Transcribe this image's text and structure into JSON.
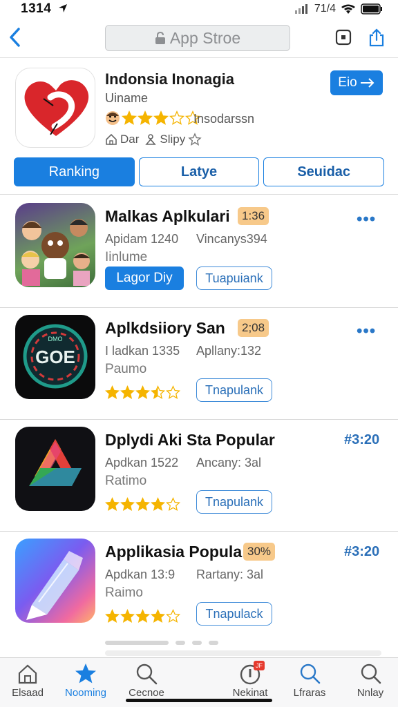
{
  "status_bar": {
    "time": "1314",
    "carrier": "71/4"
  },
  "nav": {
    "url_text": "App Stroe"
  },
  "app": {
    "title": "Indonsia Inonagia",
    "developer": "Uiname",
    "rating_stars": 3,
    "rating_label": "Insodarssn",
    "meta_left": "Dar",
    "meta_right": "Slipy",
    "get_label": "Eio"
  },
  "segments": [
    {
      "label": "Ranking",
      "active": true
    },
    {
      "label": "Latye",
      "active": false
    },
    {
      "label": "Seuidac",
      "active": false
    }
  ],
  "rows": [
    {
      "title": "Malkas Aplkulari",
      "badge": "1:36",
      "meta1": "Apidam 1240",
      "meta2": "Vincanys394",
      "sub": "Iinlume",
      "primary_label": "Lagor Diy",
      "outline_label": "Tuapuiank",
      "more": "•••"
    },
    {
      "title": "Aplkdsiiory San",
      "badge": "2;08",
      "meta1": "I ladkan 1335",
      "meta2": "Apllany:132",
      "sub": "Paumo",
      "stars": 3.5,
      "outline_label": "Tnapulank",
      "more": "•••"
    },
    {
      "title": "Dplydi Aki Sta Popular",
      "rank": "#3:20",
      "meta1": "Apdkan 1522",
      "meta2": "Ancany: 3al",
      "sub": "Ratimo",
      "stars": 4,
      "outline_label": "Tnapulank"
    },
    {
      "title": "Applikasia Popula",
      "badge": "30%",
      "rank": "#3:20",
      "meta1": "Apdkan 13:9",
      "meta2": "Rartany: 3al",
      "sub": "Raimo",
      "stars": 4,
      "outline_label": "Tnapulack"
    }
  ],
  "tabs": [
    {
      "label": "Elsaad",
      "icon": "home-icon"
    },
    {
      "label": "Nooming",
      "icon": "star-icon",
      "active": true
    },
    {
      "label": "Cecnoe",
      "icon": "search-icon"
    },
    {
      "label": "Nekinat",
      "icon": "info-icon",
      "badge": "JF"
    },
    {
      "label": "Lfraras",
      "icon": "search-icon"
    },
    {
      "label": "Nnlay",
      "icon": "search-icon"
    }
  ],
  "colors": {
    "accent": "#1a7fe0",
    "badge": "#f7c98a",
    "star": "#f5b400"
  }
}
